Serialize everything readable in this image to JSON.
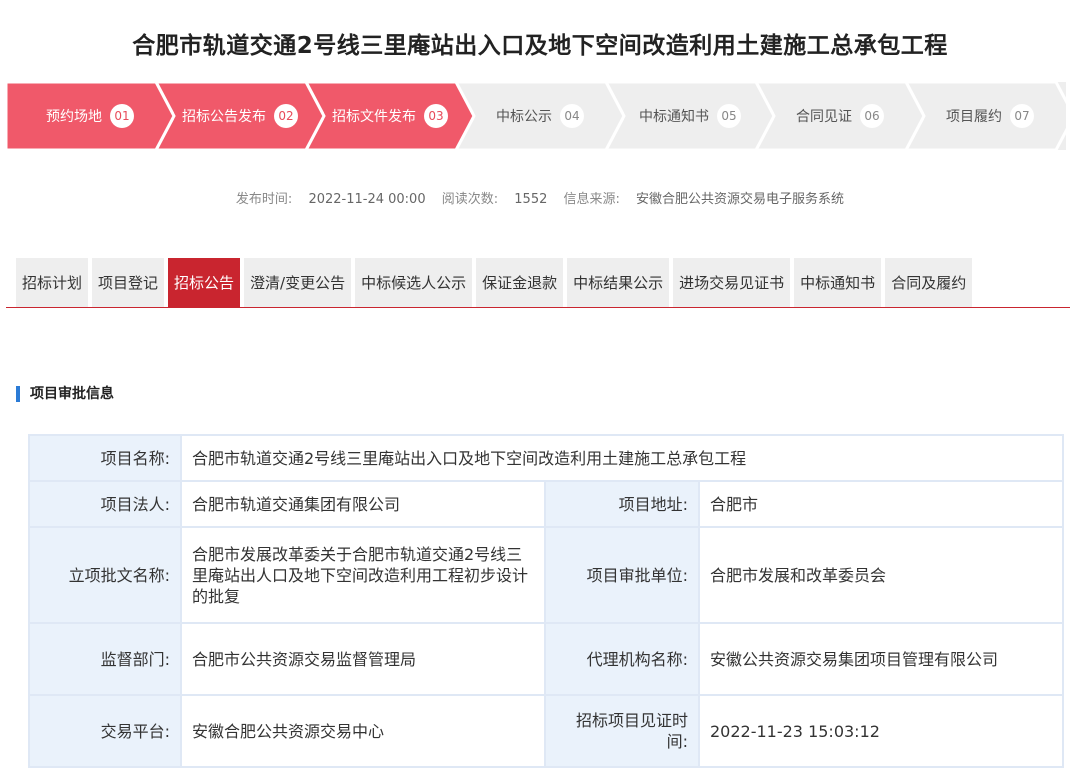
{
  "page": {
    "title": "合肥市轨道交通2号线三里庵站出入口及地下空间改造利用土建施工总承包工程"
  },
  "steps": [
    {
      "label": "预约场地",
      "num": "01",
      "active": true
    },
    {
      "label": "招标公告发布",
      "num": "02",
      "active": true
    },
    {
      "label": "招标文件发布",
      "num": "03",
      "active": true
    },
    {
      "label": "中标公示",
      "num": "04",
      "active": false
    },
    {
      "label": "中标通知书",
      "num": "05",
      "active": false
    },
    {
      "label": "合同见证",
      "num": "06",
      "active": false
    },
    {
      "label": "项目履约",
      "num": "07",
      "active": false
    }
  ],
  "meta": {
    "publish_label": "发布时间:",
    "publish_value": "2022-11-24 00:00",
    "reads_label": "阅读次数:",
    "reads_value": "1552",
    "source_label": "信息来源:",
    "source_value": "安徽合肥公共资源交易电子服务系统"
  },
  "tabs": [
    {
      "label": "招标计划",
      "active": false
    },
    {
      "label": "项目登记",
      "active": false
    },
    {
      "label": "招标公告",
      "active": true
    },
    {
      "label": "澄清/变更公告",
      "active": false
    },
    {
      "label": "中标候选人公示",
      "active": false
    },
    {
      "label": "保证金退款",
      "active": false
    },
    {
      "label": "中标结果公示",
      "active": false
    },
    {
      "label": "进场交易见证书",
      "active": false
    },
    {
      "label": "中标通知书",
      "active": false
    },
    {
      "label": "合同及履约",
      "active": false
    }
  ],
  "section": {
    "title": "项目审批信息"
  },
  "info": {
    "project_name_label": "项目名称:",
    "project_name": "合肥市轨道交通2号线三里庵站出入口及地下空间改造利用土建施工总承包工程",
    "legal_label": "项目法人:",
    "legal": "合肥市轨道交通集团有限公司",
    "address_label": "项目地址:",
    "address": "合肥市",
    "approval_doc_label": "立项批文名称:",
    "approval_doc": "合肥市发展改革委关于合肥市轨道交通2号线三里庵站出人口及地下空间改造利用工程初步设计的批复",
    "approval_unit_label": "项目审批单位:",
    "approval_unit": "合肥市发展和改革委员会",
    "supervisor_label": "监督部门:",
    "supervisor": "合肥市公共资源交易监督管理局",
    "agency_label": "代理机构名称:",
    "agency": "安徽公共资源交易集团项目管理有限公司",
    "platform_label": "交易平台:",
    "platform": "安徽合肥公共资源交易中心",
    "witness_time_label": "招标项目见证时间:",
    "witness_time": "2022-11-23 15:03:12"
  },
  "colors": {
    "step_active": "#f0596a",
    "step_inactive": "#eeeeee",
    "tab_active": "#c9252f",
    "section_accent": "#2b7bd6"
  }
}
